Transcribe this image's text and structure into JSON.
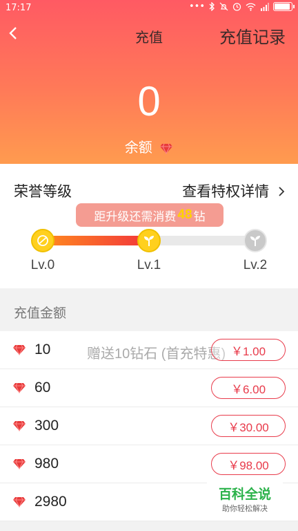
{
  "status_bar": {
    "time": "17:17",
    "icons": [
      "dots-icon",
      "bluetooth-icon",
      "mute-icon",
      "alarm-icon",
      "wifi-icon",
      "signal-icon",
      "battery-icon"
    ]
  },
  "header": {
    "title": "充值",
    "right_action": "充值记录",
    "balance": "0",
    "balance_label": "余额"
  },
  "honor": {
    "title": "荣誉等级",
    "details_link": "查看特权详情",
    "tip_prefix": "距升级还需消费",
    "tip_amount": "48",
    "tip_suffix": "钻",
    "levels": [
      "Lv.0",
      "Lv.1",
      "Lv.2"
    ],
    "current_level_index": 1
  },
  "recharge": {
    "section_title": "充值金额",
    "items": [
      {
        "amount": "10",
        "promo": "赠送10钻石 (首充特惠)",
        "price": "￥1.00"
      },
      {
        "amount": "60",
        "promo": "",
        "price": "￥6.00"
      },
      {
        "amount": "300",
        "promo": "",
        "price": "￥30.00"
      },
      {
        "amount": "980",
        "promo": "",
        "price": "￥98.00"
      },
      {
        "amount": "2980",
        "promo": "",
        "price": ""
      }
    ]
  },
  "watermark": {
    "main": "百科全说",
    "sub": "助你轻松解决"
  },
  "colors": {
    "accent": "#e83a4a",
    "gold": "#ffd01e",
    "header_top": "#ff5a63",
    "header_bottom": "#ff9b4f"
  }
}
